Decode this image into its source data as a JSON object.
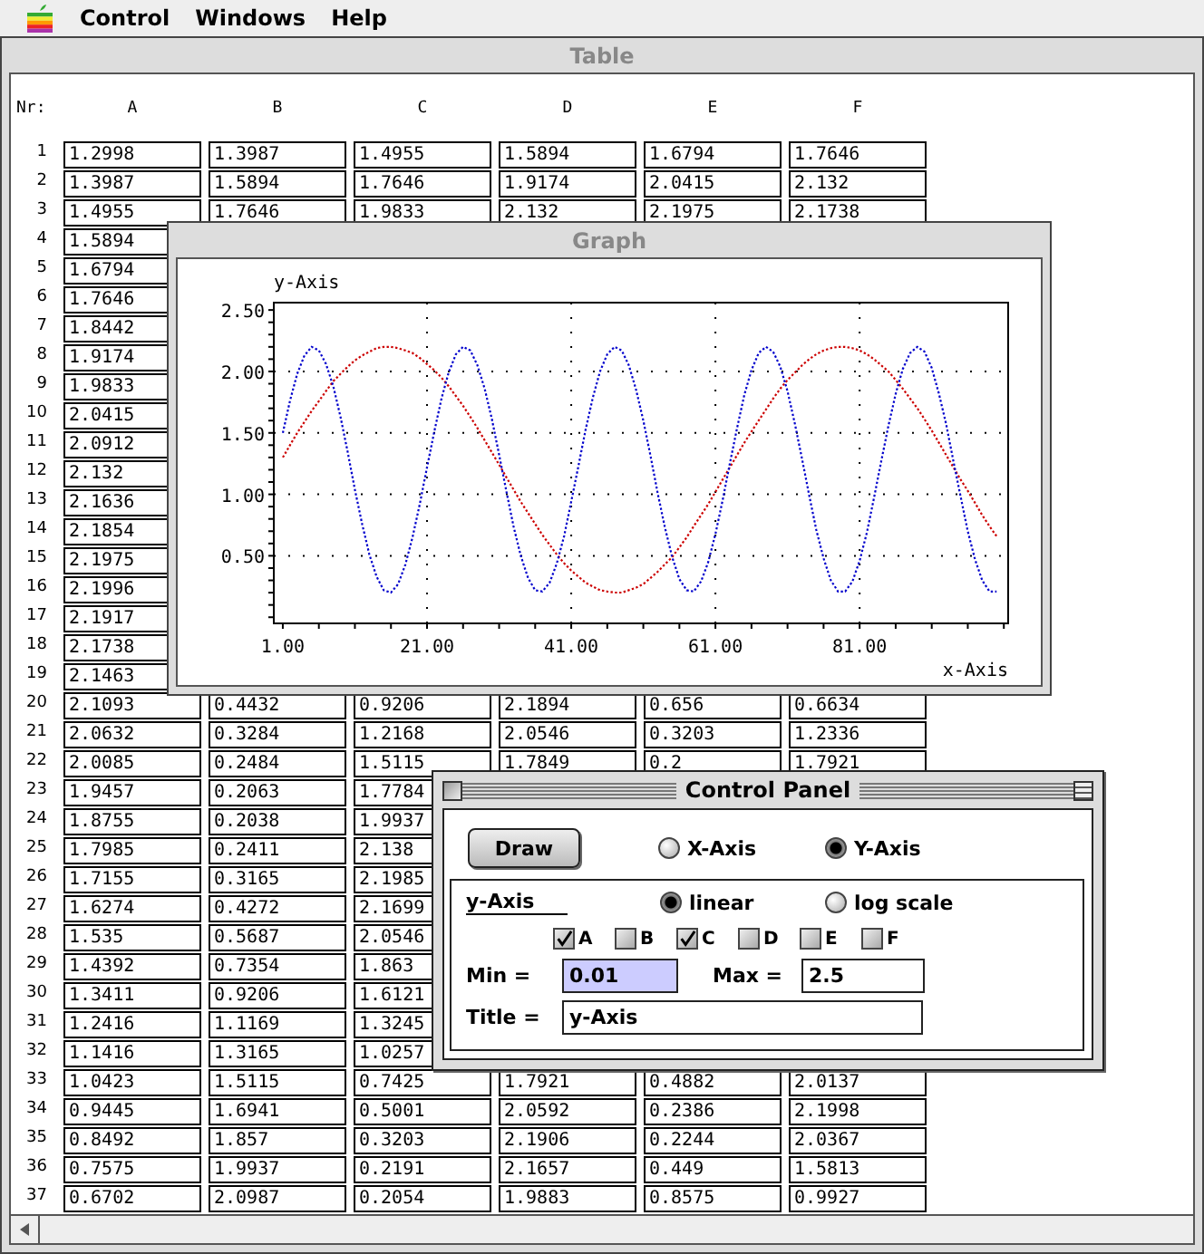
{
  "menu_bar": {
    "items": [
      "Control",
      "Windows",
      "Help"
    ]
  },
  "table_window": {
    "title": "Table",
    "row_header": "Nr:",
    "columns": [
      "A",
      "B",
      "C",
      "D",
      "E",
      "F"
    ],
    "rows": [
      {
        "nr": "1",
        "cells": [
          "1.2998",
          "1.3987",
          "1.4955",
          "1.5894",
          "1.6794",
          "1.7646"
        ]
      },
      {
        "nr": "2",
        "cells": [
          "1.3987",
          "1.5894",
          "1.7646",
          "1.9174",
          "2.0415",
          "2.132"
        ]
      },
      {
        "nr": "3",
        "cells": [
          "1.4955",
          "1.7646",
          "1.9833",
          "2.132",
          "2.1975",
          "2.1738"
        ]
      },
      {
        "nr": "4",
        "cells": [
          "1.5894",
          null,
          null,
          null,
          null,
          null
        ]
      },
      {
        "nr": "5",
        "cells": [
          "1.6794",
          null,
          null,
          null,
          null,
          null
        ]
      },
      {
        "nr": "6",
        "cells": [
          "1.7646",
          null,
          null,
          null,
          null,
          null
        ]
      },
      {
        "nr": "7",
        "cells": [
          "1.8442",
          null,
          null,
          null,
          null,
          null
        ]
      },
      {
        "nr": "8",
        "cells": [
          "1.9174",
          null,
          null,
          null,
          null,
          null
        ]
      },
      {
        "nr": "9",
        "cells": [
          "1.9833",
          null,
          null,
          null,
          null,
          null
        ]
      },
      {
        "nr": "10",
        "cells": [
          "2.0415",
          null,
          null,
          null,
          null,
          null
        ]
      },
      {
        "nr": "11",
        "cells": [
          "2.0912",
          null,
          null,
          null,
          null,
          null
        ]
      },
      {
        "nr": "12",
        "cells": [
          "2.132",
          null,
          null,
          null,
          null,
          null
        ]
      },
      {
        "nr": "13",
        "cells": [
          "2.1636",
          null,
          null,
          null,
          null,
          null
        ]
      },
      {
        "nr": "14",
        "cells": [
          "2.1854",
          null,
          null,
          null,
          null,
          null
        ]
      },
      {
        "nr": "15",
        "cells": [
          "2.1975",
          null,
          null,
          null,
          null,
          null
        ]
      },
      {
        "nr": "16",
        "cells": [
          "2.1996",
          null,
          null,
          null,
          null,
          null
        ]
      },
      {
        "nr": "17",
        "cells": [
          "2.1917",
          null,
          null,
          null,
          null,
          null
        ]
      },
      {
        "nr": "18",
        "cells": [
          "2.1738",
          null,
          null,
          null,
          null,
          null
        ]
      },
      {
        "nr": "19",
        "cells": [
          "2.1463",
          null,
          null,
          null,
          null,
          null
        ]
      },
      {
        "nr": "20",
        "cells": [
          "2.1093",
          "0.4432",
          "0.9206",
          "2.1894",
          "0.656",
          "0.6634"
        ]
      },
      {
        "nr": "21",
        "cells": [
          "2.0632",
          "0.3284",
          "1.2168",
          "2.0546",
          "0.3203",
          "1.2336"
        ]
      },
      {
        "nr": "22",
        "cells": [
          "2.0085",
          "0.2484",
          "1.5115",
          "1.7849",
          "0.2",
          "1.7921"
        ]
      },
      {
        "nr": "23",
        "cells": [
          "1.9457",
          "0.2063",
          "1.7784",
          null,
          null,
          null
        ]
      },
      {
        "nr": "24",
        "cells": [
          "1.8755",
          "0.2038",
          "1.9937",
          null,
          null,
          null
        ]
      },
      {
        "nr": "25",
        "cells": [
          "1.7985",
          "0.2411",
          "2.138",
          null,
          null,
          null
        ]
      },
      {
        "nr": "26",
        "cells": [
          "1.7155",
          "0.3165",
          "2.1985",
          null,
          null,
          null
        ]
      },
      {
        "nr": "27",
        "cells": [
          "1.6274",
          "0.4272",
          "2.1699",
          null,
          null,
          null
        ]
      },
      {
        "nr": "28",
        "cells": [
          "1.535",
          "0.5687",
          "2.0546",
          null,
          null,
          null
        ]
      },
      {
        "nr": "29",
        "cells": [
          "1.4392",
          "0.7354",
          "1.863",
          null,
          null,
          null
        ]
      },
      {
        "nr": "30",
        "cells": [
          "1.3411",
          "0.9206",
          "1.6121",
          null,
          null,
          null
        ]
      },
      {
        "nr": "31",
        "cells": [
          "1.2416",
          "1.1169",
          "1.3245",
          null,
          null,
          null
        ]
      },
      {
        "nr": "32",
        "cells": [
          "1.1416",
          "1.3165",
          "1.0257",
          null,
          null,
          null
        ]
      },
      {
        "nr": "33",
        "cells": [
          "1.0423",
          "1.5115",
          "0.7425",
          "1.7921",
          "0.4882",
          "2.0137"
        ]
      },
      {
        "nr": "34",
        "cells": [
          "0.9445",
          "1.6941",
          "0.5001",
          "2.0592",
          "0.2386",
          "2.1998"
        ]
      },
      {
        "nr": "35",
        "cells": [
          "0.8492",
          "1.857",
          "0.3203",
          "2.1906",
          "0.2244",
          "2.0367"
        ]
      },
      {
        "nr": "36",
        "cells": [
          "0.7575",
          "1.9937",
          "0.2191",
          "2.1657",
          "0.449",
          "1.5813"
        ]
      },
      {
        "nr": "37",
        "cells": [
          "0.6702",
          "2.0987",
          "0.2054",
          "1.9883",
          "0.8575",
          "0.9927"
        ]
      }
    ]
  },
  "graph_window": {
    "title": "Graph",
    "chart_data": {
      "type": "line",
      "grid": true,
      "xlabel": "x-Axis",
      "ylabel": "y-Axis",
      "xlim": [
        -0.25,
        101.6
      ],
      "ylim": [
        -0.05,
        2.56
      ],
      "xticks": [
        {
          "value": 1,
          "label": "1.00"
        },
        {
          "value": 21,
          "label": "21.00"
        },
        {
          "value": 41,
          "label": "41.00"
        },
        {
          "value": 61,
          "label": "61.00"
        },
        {
          "value": 81,
          "label": "81.00"
        }
      ],
      "yticks": [
        {
          "value": 0.5,
          "label": "0.50"
        },
        {
          "value": 1,
          "label": "1.00"
        },
        {
          "value": 1.5,
          "label": "1.50"
        },
        {
          "value": 2,
          "label": "2.00"
        },
        {
          "value": 2.5,
          "label": "2.50"
        }
      ],
      "x": [
        1,
        2,
        3,
        4,
        5,
        6,
        7,
        8,
        9,
        10,
        11,
        12,
        13,
        14,
        15,
        16,
        17,
        18,
        19,
        20,
        21,
        22,
        23,
        24,
        25,
        26,
        27,
        28,
        29,
        30,
        31,
        32,
        33,
        34,
        35,
        36,
        37,
        38,
        39,
        40,
        41,
        42,
        43,
        44,
        45,
        46,
        47,
        48,
        49,
        50,
        51,
        52,
        53,
        54,
        55,
        56,
        57,
        58,
        59,
        60,
        61,
        62,
        63,
        64,
        65,
        66,
        67,
        68,
        69,
        70,
        71,
        72,
        73,
        74,
        75,
        76,
        77,
        78,
        79,
        80,
        81,
        82,
        83,
        84,
        85,
        86,
        87,
        88,
        89,
        90,
        91,
        92,
        93,
        94,
        95,
        96,
        97,
        98,
        99,
        100
      ],
      "series": [
        {
          "color": "#cc0000",
          "line_style": "dotted",
          "values": [
            1.3,
            1.4,
            1.5,
            1.59,
            1.68,
            1.76,
            1.84,
            1.92,
            1.98,
            2.04,
            2.09,
            2.13,
            2.16,
            2.19,
            2.2,
            2.2,
            2.19,
            2.17,
            2.15,
            2.11,
            2.06,
            2.01,
            1.95,
            1.88,
            1.8,
            1.72,
            1.63,
            1.54,
            1.44,
            1.34,
            1.24,
            1.14,
            1.04,
            0.94,
            0.85,
            0.76,
            0.67,
            0.59,
            0.51,
            0.44,
            0.38,
            0.33,
            0.28,
            0.25,
            0.22,
            0.21,
            0.2,
            0.2,
            0.22,
            0.24,
            0.27,
            0.32,
            0.37,
            0.43,
            0.49,
            0.57,
            0.65,
            0.74,
            0.83,
            0.92,
            1.02,
            1.12,
            1.22,
            1.32,
            1.42,
            1.51,
            1.6,
            1.69,
            1.78,
            1.86,
            1.93,
            1.99,
            2.05,
            2.1,
            2.14,
            2.17,
            2.19,
            2.2,
            2.2,
            2.19,
            2.17,
            2.14,
            2.1,
            2.05,
            2.0,
            1.93,
            1.86,
            1.78,
            1.7,
            1.61,
            1.52,
            1.42,
            1.32,
            1.22,
            1.12,
            1.03,
            0.93,
            0.83,
            0.74,
            0.66
          ]
        },
        {
          "color": "#0000cc",
          "line_style": "dotted",
          "values": [
            1.5,
            1.76,
            1.98,
            2.13,
            2.2,
            2.17,
            2.06,
            1.88,
            1.63,
            1.34,
            1.04,
            0.76,
            0.51,
            0.33,
            0.22,
            0.2,
            0.27,
            0.43,
            0.65,
            0.92,
            1.22,
            1.51,
            1.78,
            1.99,
            2.14,
            2.2,
            2.17,
            2.05,
            1.86,
            1.61,
            1.32,
            1.03,
            0.74,
            0.5,
            0.32,
            0.22,
            0.21,
            0.28,
            0.44,
            0.66,
            0.94,
            1.23,
            1.53,
            1.79,
            2.0,
            2.14,
            2.2,
            2.17,
            2.05,
            1.85,
            1.6,
            1.31,
            1.01,
            0.73,
            0.49,
            0.31,
            0.22,
            0.21,
            0.29,
            0.45,
            0.68,
            0.95,
            1.25,
            1.54,
            1.81,
            2.01,
            2.15,
            2.2,
            2.16,
            2.04,
            1.84,
            1.58,
            1.29,
            0.99,
            0.71,
            0.48,
            0.3,
            0.21,
            0.21,
            0.29,
            0.46,
            0.69,
            0.97,
            1.27,
            1.56,
            1.82,
            2.02,
            2.15,
            2.2,
            2.16,
            2.03,
            1.82,
            1.57,
            1.27,
            0.98,
            0.7,
            0.47,
            0.3,
            0.21,
            0.21
          ]
        }
      ]
    }
  },
  "control_panel": {
    "title": "Control Panel",
    "draw_button": "Draw",
    "axis_options": [
      {
        "label": "X-Axis",
        "selected": false
      },
      {
        "label": "Y-Axis",
        "selected": true
      }
    ],
    "group": {
      "heading": "y-Axis",
      "scale_options": [
        {
          "label": "linear",
          "selected": true
        },
        {
          "label": "log scale",
          "selected": false
        }
      ],
      "series": [
        {
          "label": "A",
          "checked": true
        },
        {
          "label": "B",
          "checked": false
        },
        {
          "label": "C",
          "checked": true
        },
        {
          "label": "D",
          "checked": false
        },
        {
          "label": "E",
          "checked": false
        },
        {
          "label": "F",
          "checked": false
        }
      ],
      "min": {
        "label": "Min =",
        "value": "0.01",
        "highlighted": true
      },
      "max": {
        "label": "Max =",
        "value": "2.5",
        "highlighted": false
      },
      "title_field": {
        "label": "Title =",
        "value": "y-Axis"
      }
    }
  }
}
